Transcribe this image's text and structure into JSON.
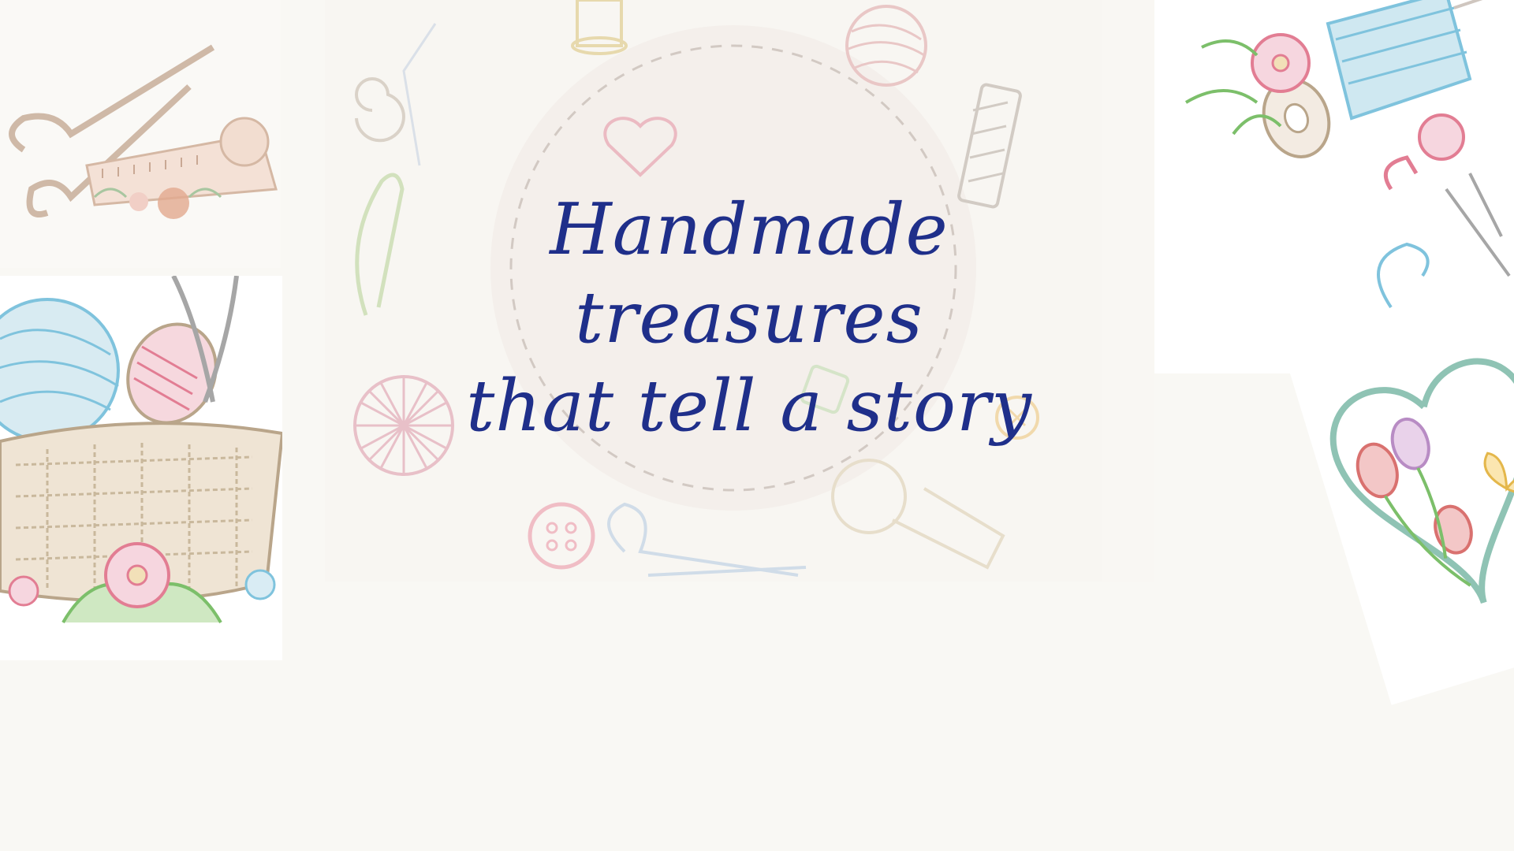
{
  "headline": {
    "line1": "Handmade treasures",
    "line2": "that tell a story"
  },
  "palette": {
    "background": "#f9f8f4",
    "headline_color": "#1f2f8a",
    "thread_blue": "#7fc3dd",
    "thread_pink": "#e27d93",
    "leaf_green": "#7cbf6a",
    "basket_tan": "#b9a58a"
  },
  "decorations": [
    "scissors-icon",
    "tape-measure-icon",
    "sewing-basket-icon",
    "thread-spool-icon",
    "yarn-ball-icon",
    "button-icon",
    "safety-pin-icon",
    "needle-icon",
    "heart-icon",
    "flower-icon",
    "tulip-icon",
    "butterfly-icon",
    "pincushion-icon"
  ]
}
